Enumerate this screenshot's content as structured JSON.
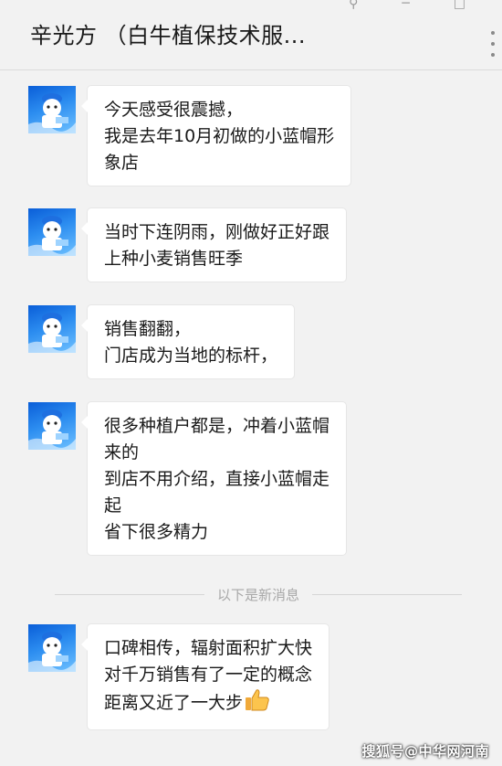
{
  "header": {
    "title": "辛光方 （白牛植保技术服..."
  },
  "messages": [
    {
      "text": "今天感受很震撼，\n我是去年10月初做的小蓝帽形\n象店"
    },
    {
      "text": "当时下连阴雨，刚做好正好跟\n上种小麦销售旺季"
    },
    {
      "text": "销售翻翻，\n门店成为当地的标杆，"
    },
    {
      "text": "很多种植户都是，冲着小蓝帽\n来的\n到店不用介绍，直接小蓝帽走\n起\n省下很多精力"
    },
    {
      "text": "口碑相传，辐射面积扩大快\n对千万销售有了一定的概念\n距离又近了一大步"
    }
  ],
  "divider": {
    "label": "以下是新消息"
  },
  "watermark": {
    "text": "搜狐号@中华网河南"
  },
  "icons": [
    "minimize-icon",
    "window-icon",
    "more-options-icon",
    "thumbs-up-icon",
    "avatar-icon"
  ]
}
